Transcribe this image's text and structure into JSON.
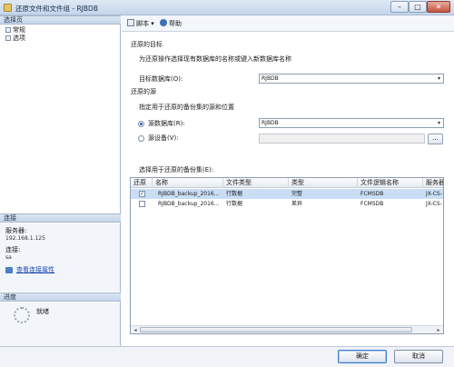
{
  "window": {
    "title": "还原文件和文件组 - RJBDB",
    "min": "–",
    "max": "□",
    "close": "✕"
  },
  "left": {
    "pages_header": "选择页",
    "pages": [
      "常规",
      "选项"
    ],
    "conn_header": "连接",
    "server_label": "服务器:",
    "server_value": "192.168.1.125",
    "conn_label": "连接:",
    "conn_value": "sa",
    "view_props": "查看连接属性",
    "progress_header": "进度",
    "progress_status": "就绪"
  },
  "toolbar": {
    "script": "脚本",
    "script_arrow": "▾",
    "help": "帮助"
  },
  "main": {
    "restore_target": "还原的目标",
    "target_desc": "为还原操作选择现有数据库的名称或键入新数据库名称",
    "target_db_label": "目标数据库(O):",
    "target_db_value": "RJBDB",
    "restore_source": "还原的源",
    "source_desc": "指定用于还原的备份集的源和位置",
    "source_db_label": "源数据库(R):",
    "source_db_value": "RJBDB",
    "source_device_label": "源设备(V):",
    "browse": "...",
    "backup_sets_label": "选择用于还原的备份集(E):",
    "columns": [
      "还原",
      "名称",
      "文件类型",
      "类型",
      "文件逻辑名称",
      "服务器"
    ],
    "rows": [
      {
        "checked": true,
        "name": "RJBDB_backup_2016...",
        "file_type": "行数据",
        "type": "完整",
        "logical_name": "FCMSDB",
        "server": "JX-CS-"
      },
      {
        "checked": false,
        "name": "RJBDB_backup_2016...",
        "file_type": "行数据",
        "type": "差异",
        "logical_name": "FCMSDB",
        "server": "JX-CS-"
      }
    ],
    "scroll_left": "◂",
    "scroll_right": "▸"
  },
  "buttons": {
    "ok": "确定",
    "cancel": "取消"
  },
  "colors": {
    "accent": "#1f5fbf",
    "selection": "#c9def5",
    "header": "#c5d6ea"
  }
}
